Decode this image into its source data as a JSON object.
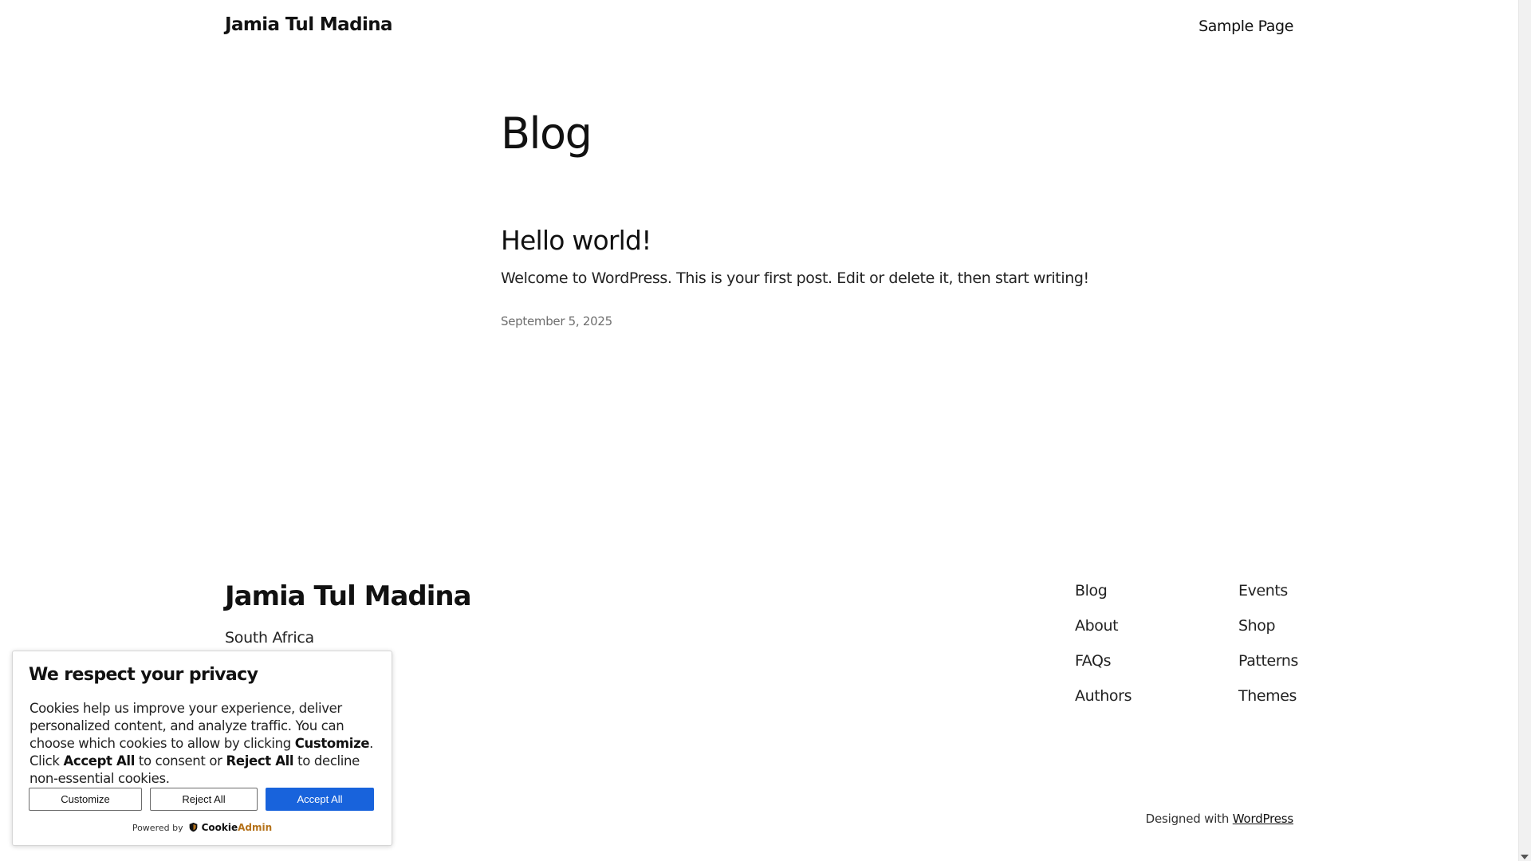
{
  "header": {
    "site_title": "Jamia Tul Madina",
    "nav": [
      {
        "label": "Sample Page"
      }
    ]
  },
  "main": {
    "page_title": "Blog",
    "posts": [
      {
        "title": "Hello world!",
        "excerpt": "Welcome to WordPress. This is your first post. Edit or delete it, then start writing!",
        "date": "September 5, 2025"
      }
    ]
  },
  "footer": {
    "site_title": "Jamia Tul Madina",
    "tagline": "South Africa",
    "links_col1": [
      {
        "label": "Blog"
      },
      {
        "label": "About"
      },
      {
        "label": "FAQs"
      },
      {
        "label": "Authors"
      }
    ],
    "links_col2": [
      {
        "label": "Events"
      },
      {
        "label": "Shop"
      },
      {
        "label": "Patterns"
      },
      {
        "label": "Themes"
      }
    ],
    "credit_prefix": "Designed with",
    "credit_link": "WordPress"
  },
  "cookie_banner": {
    "heading": "We respect your privacy",
    "text_part1": "Cookies help us improve your experience, deliver personalized content, and analyze traffic. You can choose which cookies to allow by clicking ",
    "text_customize": "Customize",
    "text_part2": ". Click ",
    "text_accept": "Accept All",
    "text_part3": " to consent or ",
    "text_reject": "Reject All",
    "text_part4": " to decline non-essential cookies.",
    "buttons": {
      "customize": "Customize",
      "reject": "Reject All",
      "accept": "Accept All"
    },
    "powered_by": "Powered by",
    "brand_part1": "Cookie",
    "brand_part2": "Admin",
    "colors": {
      "accept_bg": "#1863dc",
      "brand_accent": "#b5721a"
    }
  }
}
